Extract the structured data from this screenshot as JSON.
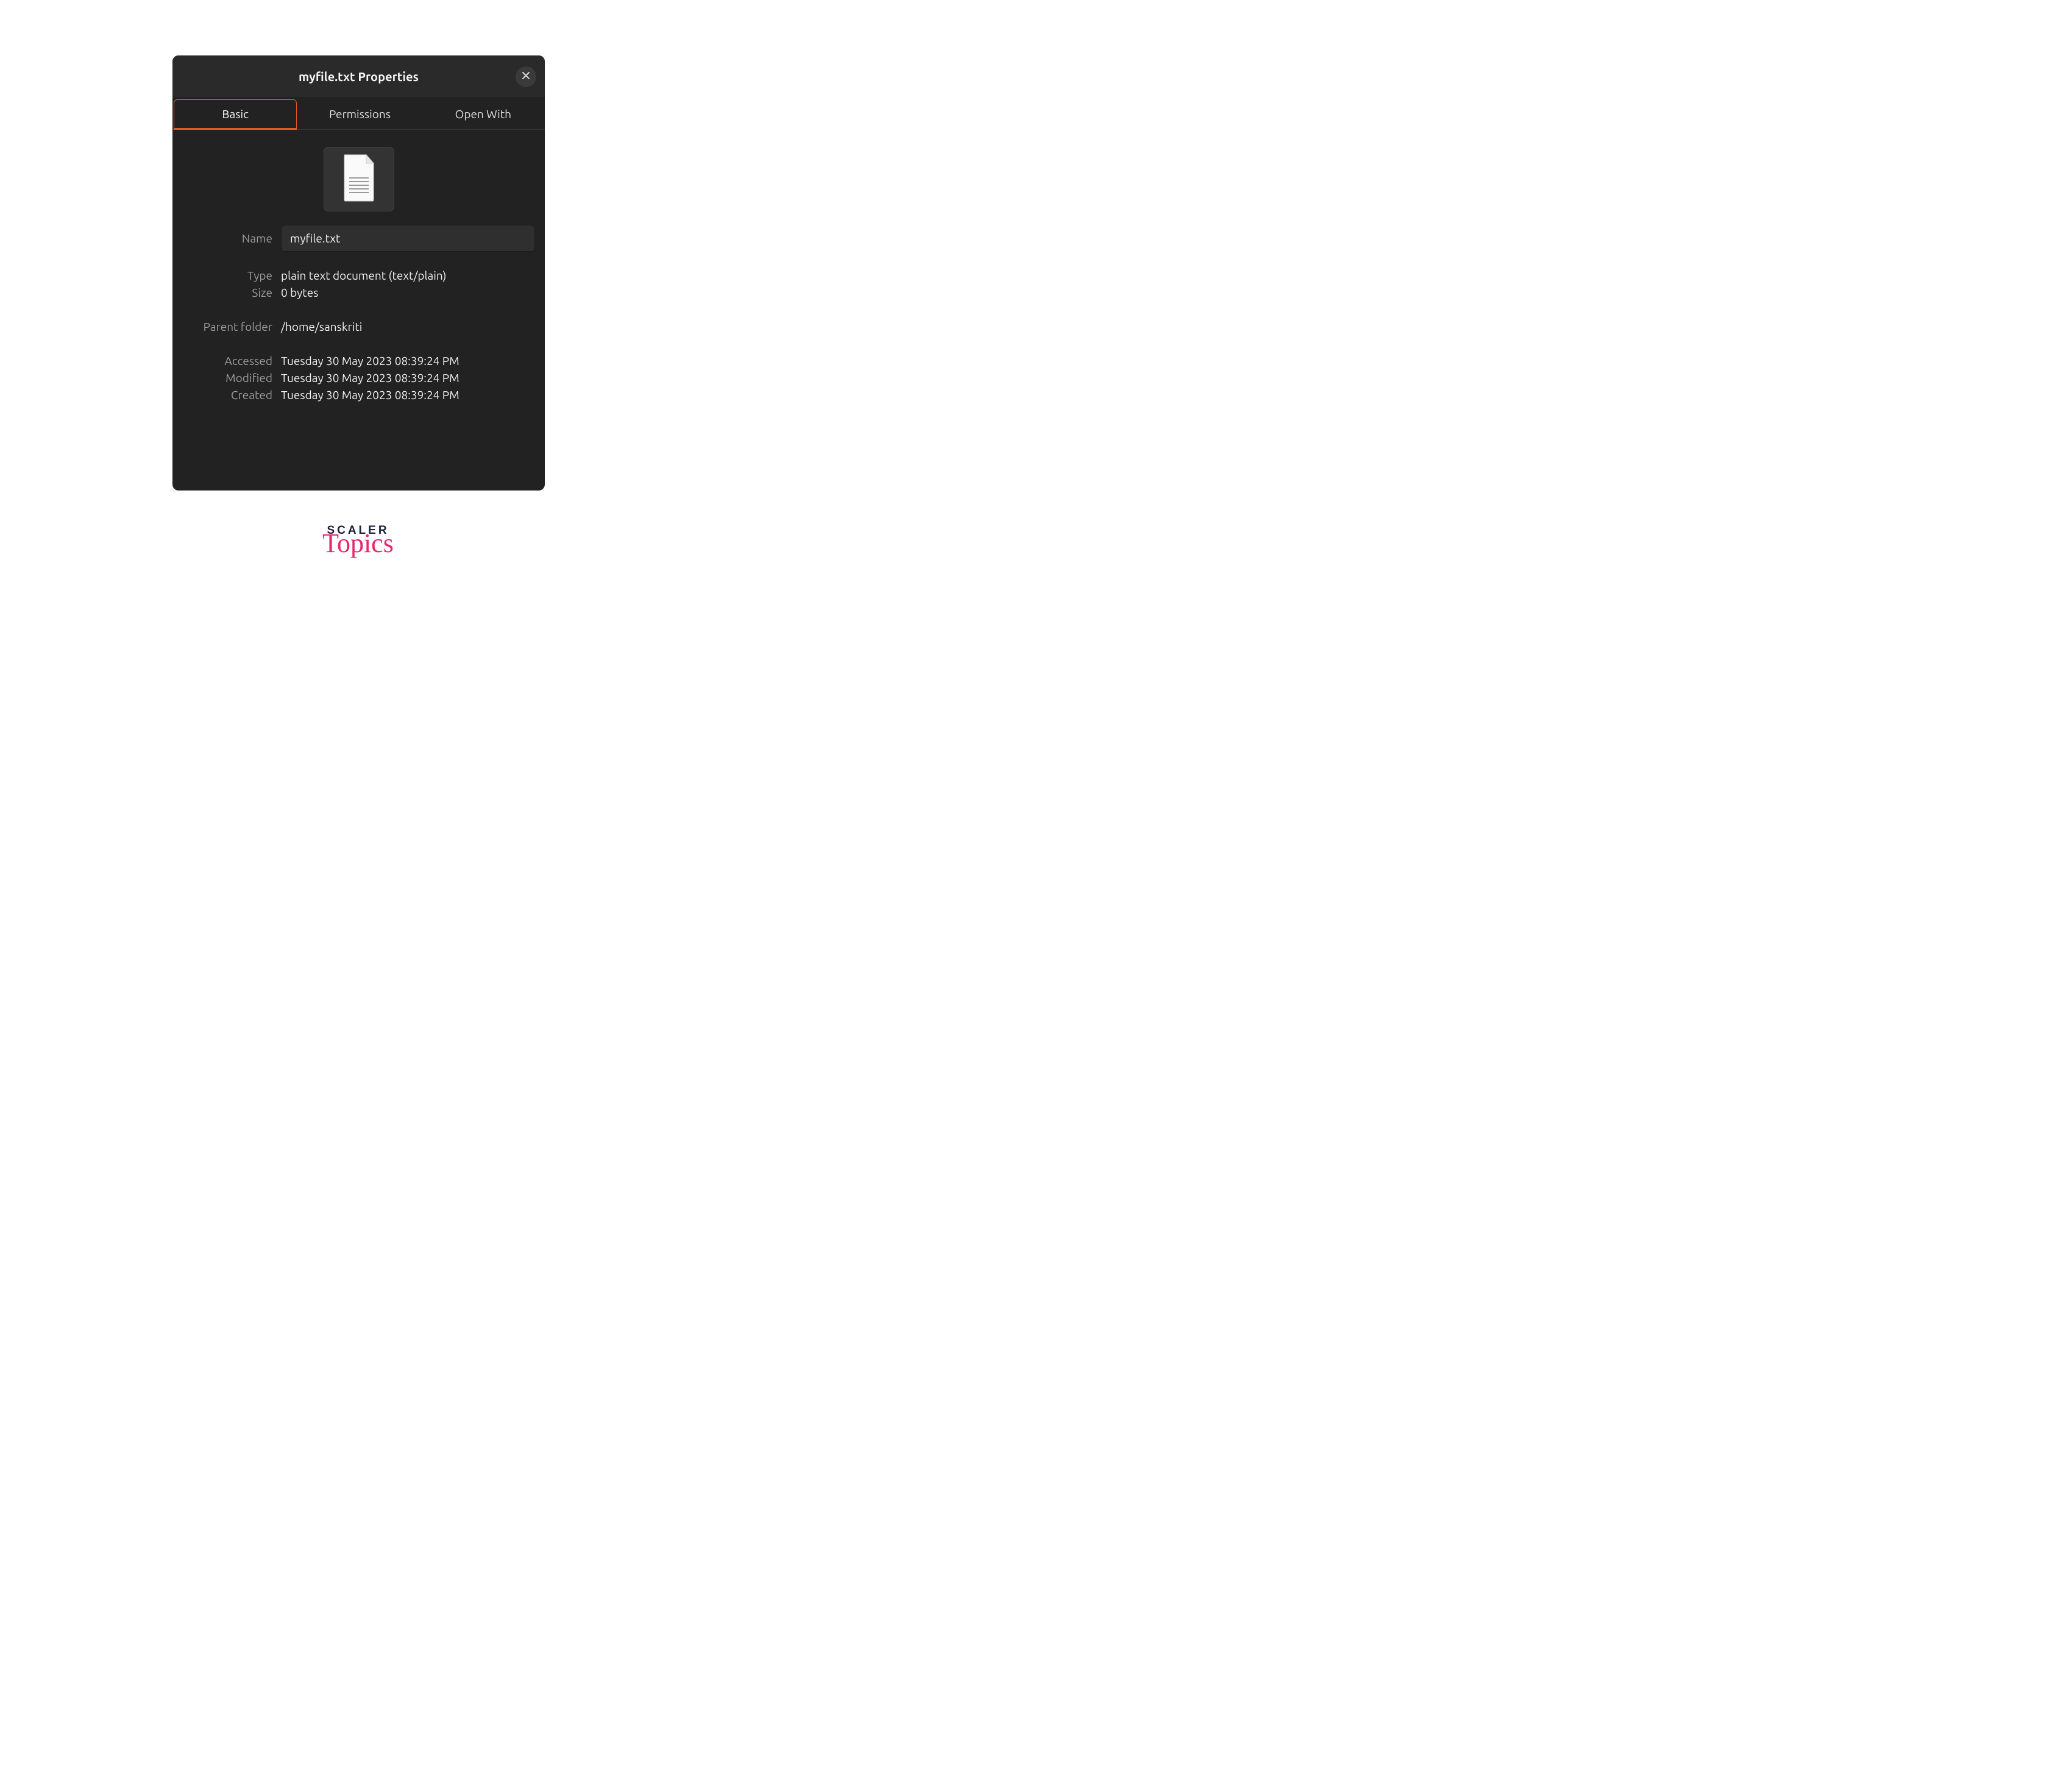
{
  "titlebar": {
    "title": "myfile.txt Properties"
  },
  "tabs": {
    "basic": "Basic",
    "permissions": "Permissions",
    "open_with": "Open With"
  },
  "labels": {
    "name": "Name",
    "type": "Type",
    "size": "Size",
    "parent_folder": "Parent folder",
    "accessed": "Accessed",
    "modified": "Modified",
    "created": "Created"
  },
  "values": {
    "name": "myfile.txt",
    "type": "plain text document (text/plain)",
    "size": "0 bytes",
    "parent_folder": "/home/sanskriti",
    "accessed": "Tuesday 30 May 2023 08:39:24 PM",
    "modified": "Tuesday 30 May 2023 08:39:24 PM",
    "created": "Tuesday 30 May 2023 08:39:24 PM"
  },
  "watermark": {
    "line1": "SCALER",
    "line2": "Topics"
  },
  "colors": {
    "accent": "#e55b1f",
    "dialog_bg": "#222222",
    "header_bg": "#2a2a2a"
  }
}
